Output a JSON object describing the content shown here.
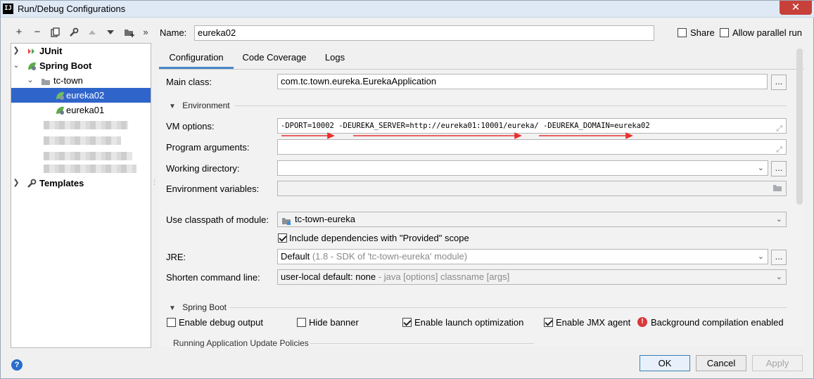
{
  "window": {
    "title": "Run/Debug Configurations",
    "app_icon": "IJ",
    "close_glyph": "✕"
  },
  "toolbar": {
    "icons": [
      "add-icon",
      "remove-icon",
      "copy-icon",
      "wrench-icon",
      "move-up-icon",
      "move-down-icon",
      "new-folder-icon",
      "more-icon"
    ],
    "add": "+",
    "remove": "−",
    "more": "»"
  },
  "tree": {
    "junit": "JUnit",
    "spring_boot": "Spring Boot",
    "tc_town": "tc-town",
    "eureka02": "eureka02",
    "eureka01": "eureka01",
    "templates": "Templates"
  },
  "header": {
    "name_label": "Name:",
    "name_value": "eureka02",
    "share_label": "Share",
    "allow_parallel_label": "Allow parallel run",
    "share_checked": false,
    "allow_parallel_checked": false
  },
  "tabs": [
    "Configuration",
    "Code Coverage",
    "Logs"
  ],
  "config": {
    "main_class_label": "Main class:",
    "main_class_value": "com.tc.town.eureka.EurekaApplication",
    "dots": "...",
    "environment_label": "Environment",
    "vm_options_label": "VM options:",
    "vm_options_value": "-DPORT=10002 -DEUREKA_SERVER=http://eureka01:10001/eureka/ -DEUREKA_DOMAIN=eureka02",
    "program_args_label": "Program arguments:",
    "program_args_value": "",
    "working_dir_label": "Working directory:",
    "working_dir_value": "",
    "env_vars_label": "Environment variables:",
    "env_vars_value": "",
    "classpath_label": "Use classpath of module:",
    "classpath_value": "tc-town-eureka",
    "include_deps_label": "Include dependencies with \"Provided\" scope",
    "include_deps_checked": true,
    "jre_label": "JRE:",
    "jre_value": "Default",
    "jre_hint": "(1.8 - SDK of 'tc-town-eureka' module)",
    "shorten_label": "Shorten command line:",
    "shorten_value": "user-local default: none",
    "shorten_hint": "- java [options] classname [args]"
  },
  "spring_boot": {
    "section_label": "Spring Boot",
    "debug_output_label": "Enable debug output",
    "debug_output_checked": false,
    "hide_banner_label": "Hide banner",
    "hide_banner_checked": false,
    "launch_opt_label": "Enable launch optimization",
    "launch_opt_checked": true,
    "jmx_label": "Enable JMX agent",
    "jmx_checked": true,
    "bg_compilation_label": "Background compilation enabled",
    "update_policies_label": "Running Application Update Policies"
  },
  "footer": {
    "help": "?",
    "ok": "OK",
    "cancel": "Cancel",
    "apply": "Apply"
  },
  "colors": {
    "selection": "#2f65ca",
    "accent_tab": "#4a86c8",
    "annotation_arrow": "#e8302f",
    "error": "#d9383a"
  }
}
